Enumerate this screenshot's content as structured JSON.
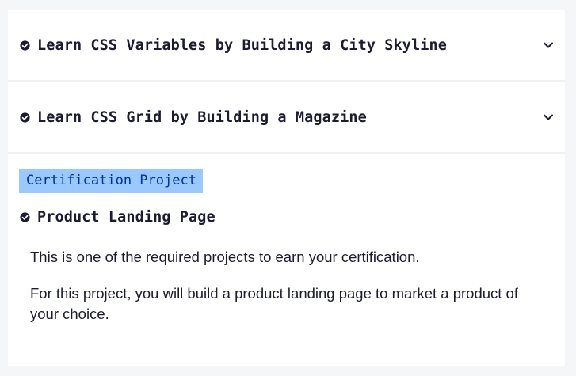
{
  "accordions": [
    {
      "title": "Learn CSS Variables by Building a City Skyline",
      "completed": true
    },
    {
      "title": "Learn CSS Grid by Building a Magazine",
      "completed": true
    }
  ],
  "certification": {
    "badge": "Certification Project",
    "project_title": "Product Landing Page",
    "completed": true,
    "paragraphs": [
      "This is one of the required projects to earn your certification.",
      "For this project, you will build a product landing page to market a product of your choice."
    ]
  },
  "icons": {
    "completed": "check-circle-icon",
    "expand": "chevron-down-icon"
  },
  "colors": {
    "page_background": "#f5f6f7",
    "card_background": "#ffffff",
    "text": "#1b1b32",
    "badge_background": "#99c9ff",
    "badge_text": "#002ead"
  }
}
